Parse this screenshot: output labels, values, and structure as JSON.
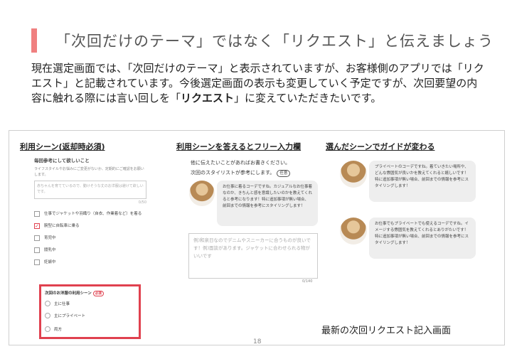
{
  "slide": {
    "title": "「次回だけのテーマ」ではなく「リクエスト」と伝えましょう",
    "body_part1": "現在選定画面では、「次回だけのテーマ」と表示されていますが、お客様側のアプリでは「リクエスト」と記載されています。今後選定画面の表示も変更していく予定ですが、次回要望の内容に触れる際には言い回しを「",
    "body_bold": "リクエスト",
    "body_part2": "」に変えていただきたいです。",
    "caption": "最新の次回リクエスト記入画面",
    "page_number": "18"
  },
  "columns": {
    "left_heading": "利用シーン(返却時必須)",
    "middle_heading": "利用シーンを答えるとフリー入力欄",
    "right_heading": "選んだシーンでガイドが変わる"
  },
  "form": {
    "subheading": "毎回参考にして欲しいこと",
    "hint": "ライフスタイルやお悩みにご変更がないか、定期的にご確認をお願いします。",
    "textarea_placeholder": "赤ちゃんを育てているので、動けそうな丈のお洋服は避けて欲しいです。",
    "textarea_count": "0/50",
    "checkboxes": [
      {
        "label": "仕事でジャケットや羽織り（自衣、作業着など）を着る",
        "checked": false
      },
      {
        "label": "腕型に自転車に乗る",
        "checked": true
      },
      {
        "label": "育児中",
        "checked": false
      },
      {
        "label": "闘乳中",
        "checked": false
      },
      {
        "label": "妊娠中",
        "checked": false
      }
    ],
    "next_usage_label": "次回のお洋服の利用シーン",
    "required_badge": "必須",
    "radios": [
      "主に仕事",
      "主にプライベート",
      "両方"
    ]
  },
  "middle": {
    "intro_line1": "他に伝えたいことがあればお書きください。",
    "intro_line2": "次回のスタイリストが参考にします。",
    "example_pill": "任意",
    "bubble": "お仕事に着るコーデですね。カジュアルなお仕事着なのか、きちんと感を意識したいのかを教えてくれると参考になります！特に追加事項が無い場合、前回までの情報を参考にスタイリングします！",
    "input_placeholder": "例)和泉日なのでデニムやスニーカーに合うものが良いです！例)面談があります。ジャケットに合わせられる物がいいです",
    "input_count": "0/140"
  },
  "right": {
    "bubble1": "プライベートのコーデですね。着ていきたい場所や、どんな雰囲気が良いかを教えてくれると嬉しいです！特に追加事項が無い場合、前回までの情報を参考にスタイリングします！",
    "bubble2": "お仕事でもプライベートでも使えるコーデですね。イメージする雰囲気を教えてくれるとありがたいです！特に追加事項が無い場合、前回までの情報を参考にスタイリングします！"
  }
}
